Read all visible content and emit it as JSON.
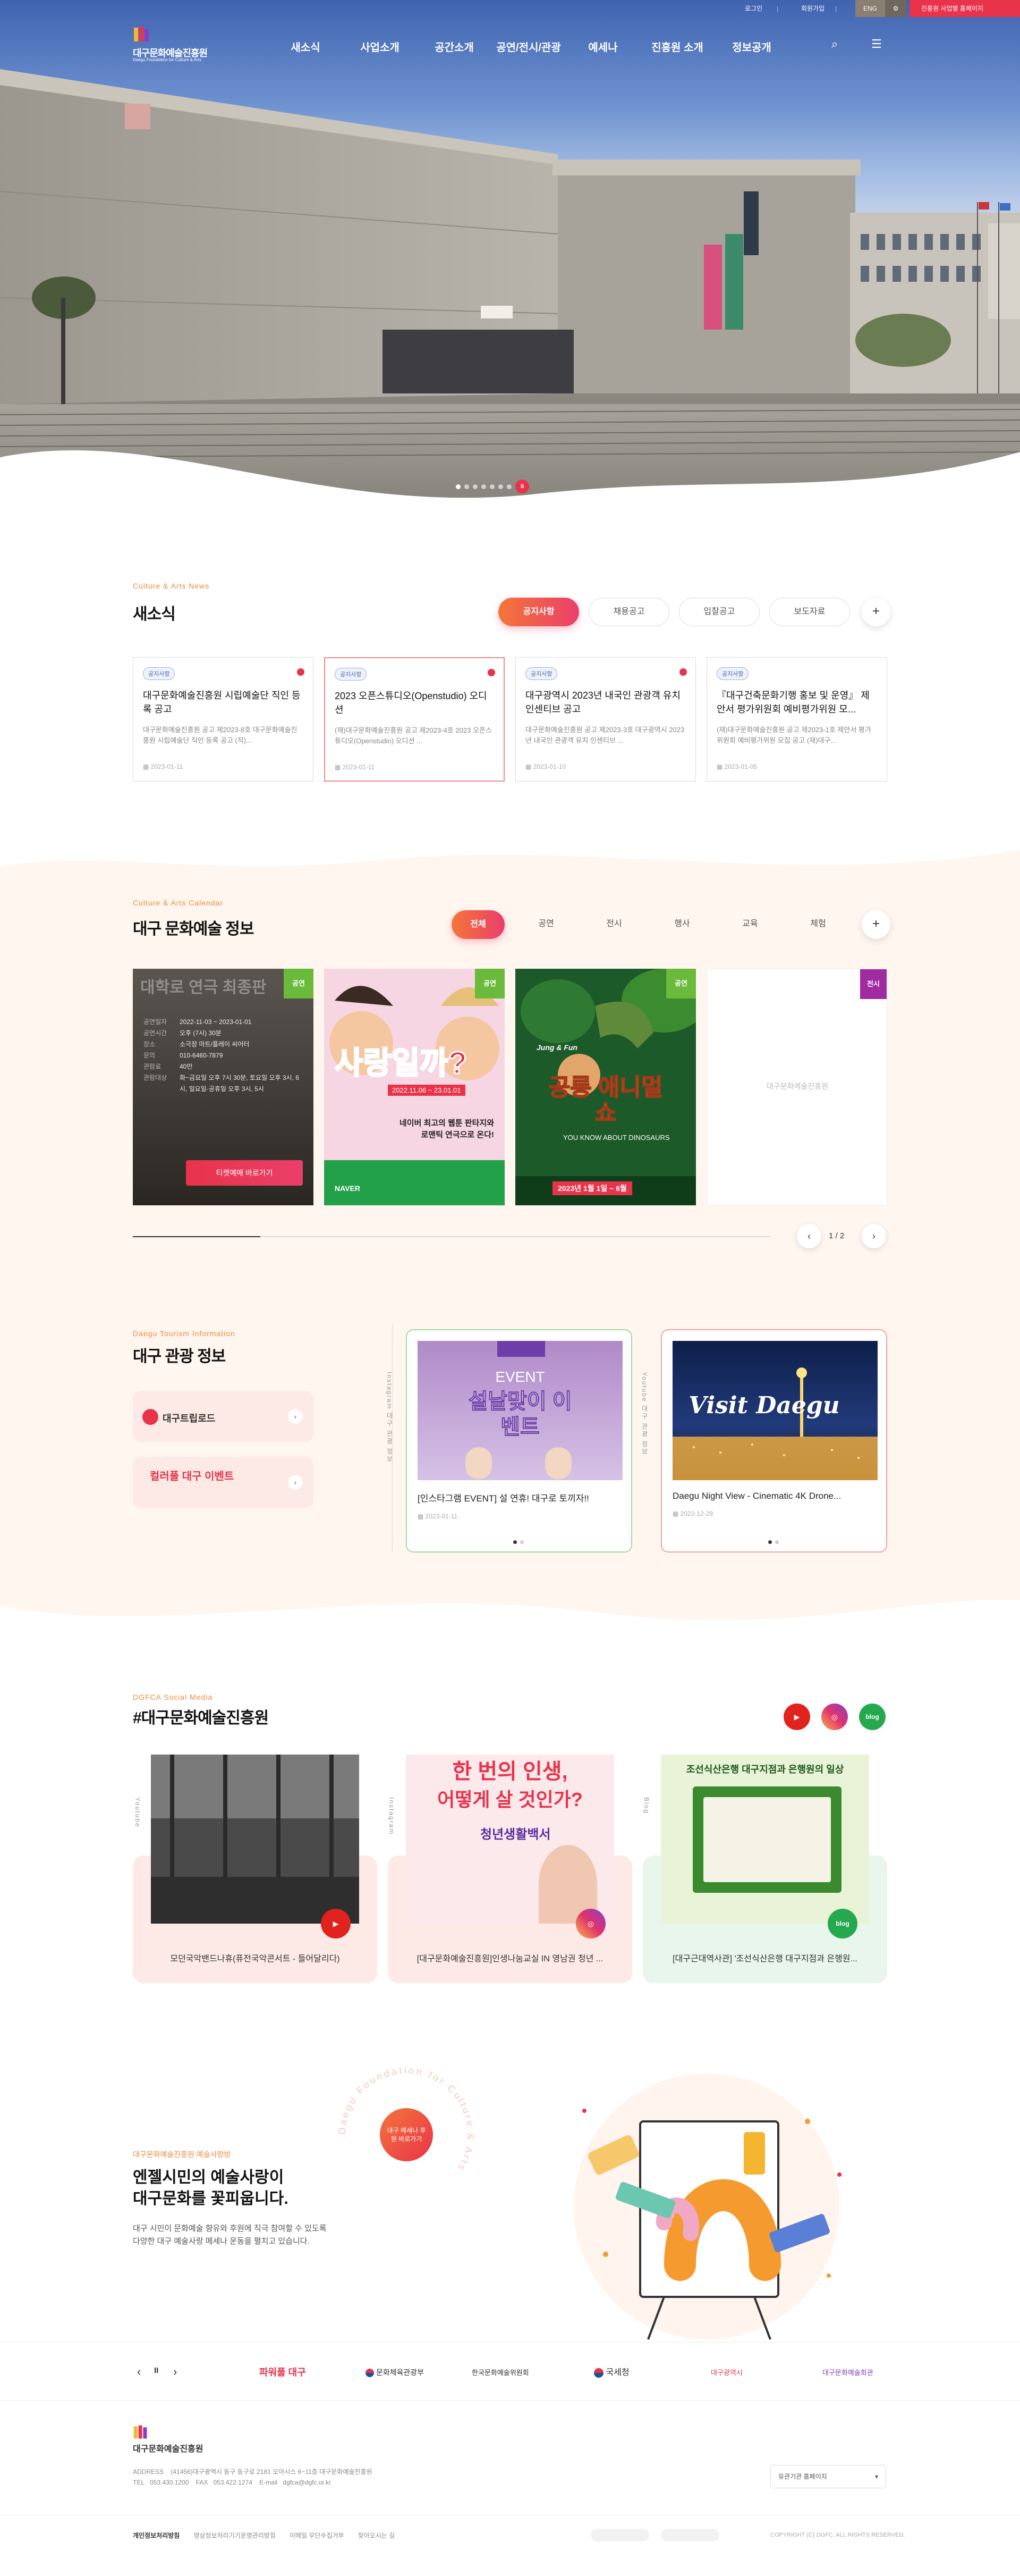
{
  "util": {
    "login": "로그인",
    "join": "회원가입",
    "eng": "ENG",
    "cta": "진흥원 사업별 홈페이지"
  },
  "header": {
    "logo": "대구문화예술진흥원",
    "logo_sub": "Daegu Foundation for Culture & Arts",
    "menu": [
      "새소식",
      "사업소개",
      "공간소개",
      "공연/전시/관광",
      "예세나",
      "진흥원 소개",
      "정보공개"
    ]
  },
  "hero": {
    "pager_current": "II"
  },
  "news": {
    "eyebrow": "Culture & Arts News",
    "title": "새소식",
    "tabs": [
      "공지사항",
      "채용공고",
      "입찰공고",
      "보도자료"
    ],
    "plus": "+",
    "cards": [
      {
        "badge": "공지사항",
        "title": "대구문화예술진흥원 시립예술단 직인 등록 공고",
        "desc": "대구문화예술진흥원 공고 제2023-8호 대구문화예술진흥원 시립예술단 직인 등록 공고 (직)...",
        "date": "2023-01-11"
      },
      {
        "badge": "공지사항",
        "title": "2023 오픈스튜디오(Openstudio) 오디션",
        "desc": "(재)대구문화예술진흥원 공고 제2023-4호 2023 오픈스튜디오(Openstudio) 오디션 ...",
        "date": "2023-01-11"
      },
      {
        "badge": "공지사항",
        "title": "대구광역시 2023년 내국인 관광객 유치 인센티브 공고",
        "desc": "대구문화예술진흥원 공고 제2023-3호 대구광역시 2023년 내국인 관광객 유치 인센티브 ...",
        "date": "2023-01-10"
      },
      {
        "badge": "공지사항",
        "title": "『대구건축문화기행 홍보 및 운영』 제안서 평가위원회 예비평가위원 모...",
        "desc": "(재)대구문화예술진흥원 공고 제2023-1호 제안서 평가위원회 예비평가위원 모집 공고 (재)대구...",
        "date": "2023-01-05"
      }
    ]
  },
  "calendar": {
    "eyebrow": "Culture & Arts Calendar",
    "title": "대구 문화예술 정보",
    "tabs": [
      "전체",
      "공연",
      "전시",
      "행사",
      "교육",
      "체험"
    ],
    "plus": "+",
    "card1": {
      "tag": "공연",
      "rows": [
        [
          "공연일자",
          "2022-11-03 ~ 2023-01-01"
        ],
        [
          "공연시간",
          "오후 (7시) 30분"
        ],
        [
          "장소",
          "소극장 마트/플레이 씨어터"
        ],
        [
          "문의",
          "010-6460-7879"
        ],
        [
          "관람료",
          "40만"
        ],
        [
          "관람대상",
          "화~금요일 오후 7시 30분, 토요일 오후 3시, 6시, 일요일·공휴일 오후 3시, 5시"
        ]
      ],
      "button": "티켓예매 바로가기",
      "overlay": "대학로 연극 최종판"
    },
    "card2": {
      "tag": "공연",
      "headline": "사랑일까?",
      "date": "2022.11.06 ~ 23.01.01",
      "sub": "네이버 최고의 웹툰 판타지와 로맨틱 연극으로 온다!",
      "brand": "NAVER"
    },
    "card3": {
      "tag": "공연",
      "pre": "Jung & Fun",
      "headline": "공룡 애니멀 쇼",
      "date": "2023년 1월 1일 ~ 6월",
      "sub": "YOU KNOW ABOUT DINOSAURS"
    },
    "card4": {
      "tag": "전시",
      "placeholder": "대구문화예술진흥원"
    },
    "page": "1 / 2",
    "prev": "‹",
    "next": "›"
  },
  "tourism": {
    "eyebrow": "Daegu Tourism Information",
    "title": "대구 관광 정보",
    "btn1": "대구트립로드",
    "btn2": "컬러풀 대구 이벤트",
    "vertical1": "Instagram 대구 관광 정보",
    "vertical2": "Youtube 대구 관광 정보",
    "card1": {
      "img_title": "EVENT",
      "img_big": "설날맞이 이벤트",
      "title": "[인스타그램 EVENT] 설 연휴! 대구로 토끼자!!",
      "date": "2023-01-11"
    },
    "card2": {
      "img_title": "Visit Daegu",
      "title": "Daegu Night View - Cinematic 4K Drone...",
      "date": "2022-12-29"
    }
  },
  "social": {
    "eyebrow": "DGFCA Social Media",
    "title": "#대구문화예술진흥원",
    "icons": [
      "YouTube",
      "Instagram",
      "blog"
    ],
    "labels": [
      "Youtube",
      "Instagram",
      "Blog"
    ],
    "cards": [
      {
        "title": "모던국악밴드나휴(퓨전국악콘서트 - 들어달리다)",
        "icon": "▶"
      },
      {
        "title": "[대구문화예술진흥원]인생나눔교실 IN 영남권 청년 ...",
        "icon": "◎",
        "img_top": "한 번의 인생,",
        "img_main": "어떻게 살 것인가?",
        "img_sub": "청년생활백서"
      },
      {
        "title": "[대구근대역사관] '조선식산은행 대구지점과 은행원...",
        "icon": "blog",
        "img_top": "조선식산은행 대구지점과 은행원의 일상"
      }
    ]
  },
  "promo": {
    "eyebrow": "대구문화예술진흥원 예술사랑방",
    "line1": "엔젤시민의 예술사랑이",
    "line2": "대구문화를 꽃피웁니다.",
    "desc1": "대구 시민이 문화예술 향유와 후원에 직극 참여할 수 있도록",
    "desc2": "다양한 대구 예술사랑 메세나 운동을 펼치고 있습니다.",
    "circle_text": "대구 메세나 후원 바로가기",
    "ring_text": "Daegu Foundation for Culture & Arts"
  },
  "partners": {
    "controls": [
      "‹",
      "II",
      "›"
    ],
    "logos": [
      "파워풀 대구",
      "문화체육관광부",
      "한국문화예술위원회",
      "국세청",
      "대구광역시",
      "대구문화예술회관"
    ]
  },
  "footer": {
    "logo": "대구문화예술진흥원",
    "address_label": "ADDRESS",
    "address": "(41456)대구광역시 동구 동구로 2181 오아시스 6~11층 대구문화예술진흥원",
    "tel_label": "TEL",
    "tel": "053.430.1200",
    "fax_label": "FAX",
    "fax": "053.422.1274",
    "email_label": "E-mail",
    "email": "dgfca@dgfc.or.kr",
    "links": [
      "개인정보처리방침",
      "영상정보처리기기운영관리방침",
      "이메일 무단수집거부",
      "찾아오시는 길"
    ],
    "family": "유관기관 홈페이지",
    "copyright": "COPYRIGHT (C) DGFC. ALL RIGHTS RESERVED."
  }
}
